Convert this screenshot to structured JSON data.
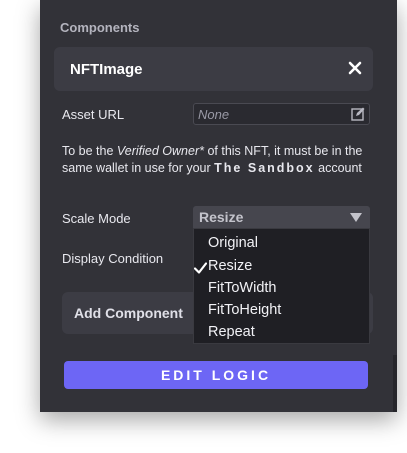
{
  "section_header": "Components",
  "component": {
    "title": "NFTImage",
    "close_icon": "close-icon"
  },
  "asset_url": {
    "label": "Asset URL",
    "placeholder": "None",
    "value": "",
    "edit_icon": "edit-icon"
  },
  "info": {
    "prefix": "To be the ",
    "emphasis": "Verified Owner*",
    "middle": " of this NFT, it must be in the same wallet in use for your ",
    "brand": "The Sandbox",
    "suffix": " account"
  },
  "scale_mode": {
    "label": "Scale Mode",
    "selected": "Resize",
    "options": [
      "Original",
      "Resize",
      "FitToWidth",
      "FitToHeight",
      "Repeat"
    ]
  },
  "display_condition": {
    "label": "Display Condition"
  },
  "add_component": {
    "label": "Add Component"
  },
  "edit_logic": {
    "label": "EDIT LOGIC"
  },
  "colors": {
    "panel_bg": "#323238",
    "card_bg": "#3c3c44",
    "accent": "#6d66f5",
    "dropdown_bg": "#1f1f24"
  }
}
